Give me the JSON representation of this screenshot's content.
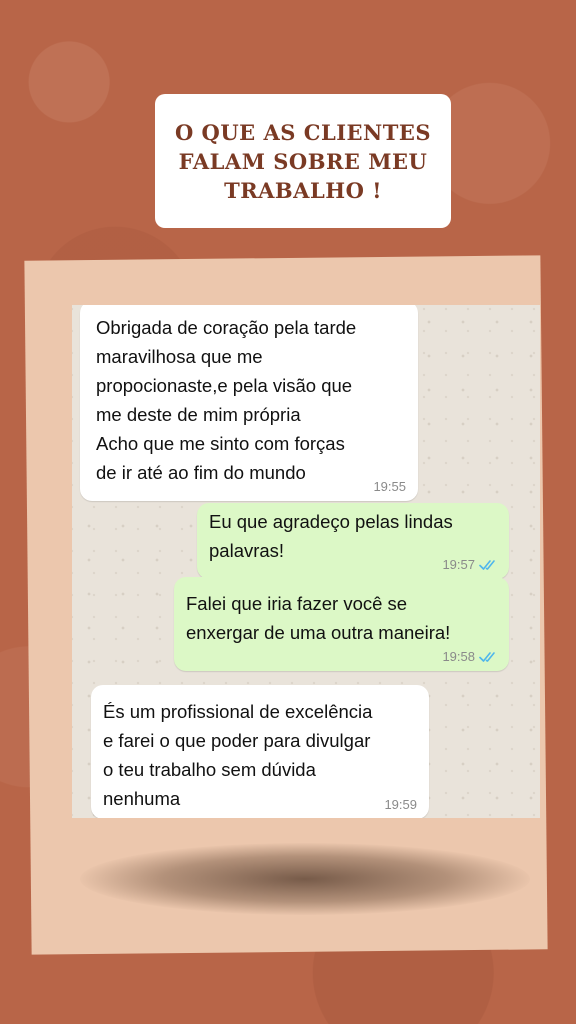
{
  "title": {
    "text": "O QUE AS CLIENTES\nFALAM SOBRE MEU\nTRABALHO !"
  },
  "colors": {
    "background": "#b86548",
    "title_text": "#7a3a24",
    "frame": "#ecc7ad",
    "incoming_bubble": "#ffffff",
    "outgoing_bubble": "#dcf8c6",
    "read_ticks": "#4fb6ec"
  },
  "chat": {
    "messages": [
      {
        "direction": "incoming",
        "text": "Obrigada de coração  pela tarde\nmaravilhosa que me\npropocionaste,e pela visão que\nme deste de mim própria\nAcho que me sinto com forças\nde ir até ao fim do mundo",
        "time": "19:55",
        "status_icon": ""
      },
      {
        "direction": "outgoing",
        "text": "Eu que agradeço pelas lindas\npalavras!",
        "time": "19:57",
        "status_icon": "double-check-read-icon"
      },
      {
        "direction": "outgoing",
        "text": "Falei que iria fazer você se\nenxergar de uma outra maneira!",
        "time": "19:58",
        "status_icon": "double-check-read-icon"
      },
      {
        "direction": "incoming",
        "text": "És um profissional de excelência\ne farei o que poder para divulgar\no teu trabalho sem dúvida\nnenhuma",
        "time": "19:59",
        "status_icon": ""
      }
    ]
  }
}
